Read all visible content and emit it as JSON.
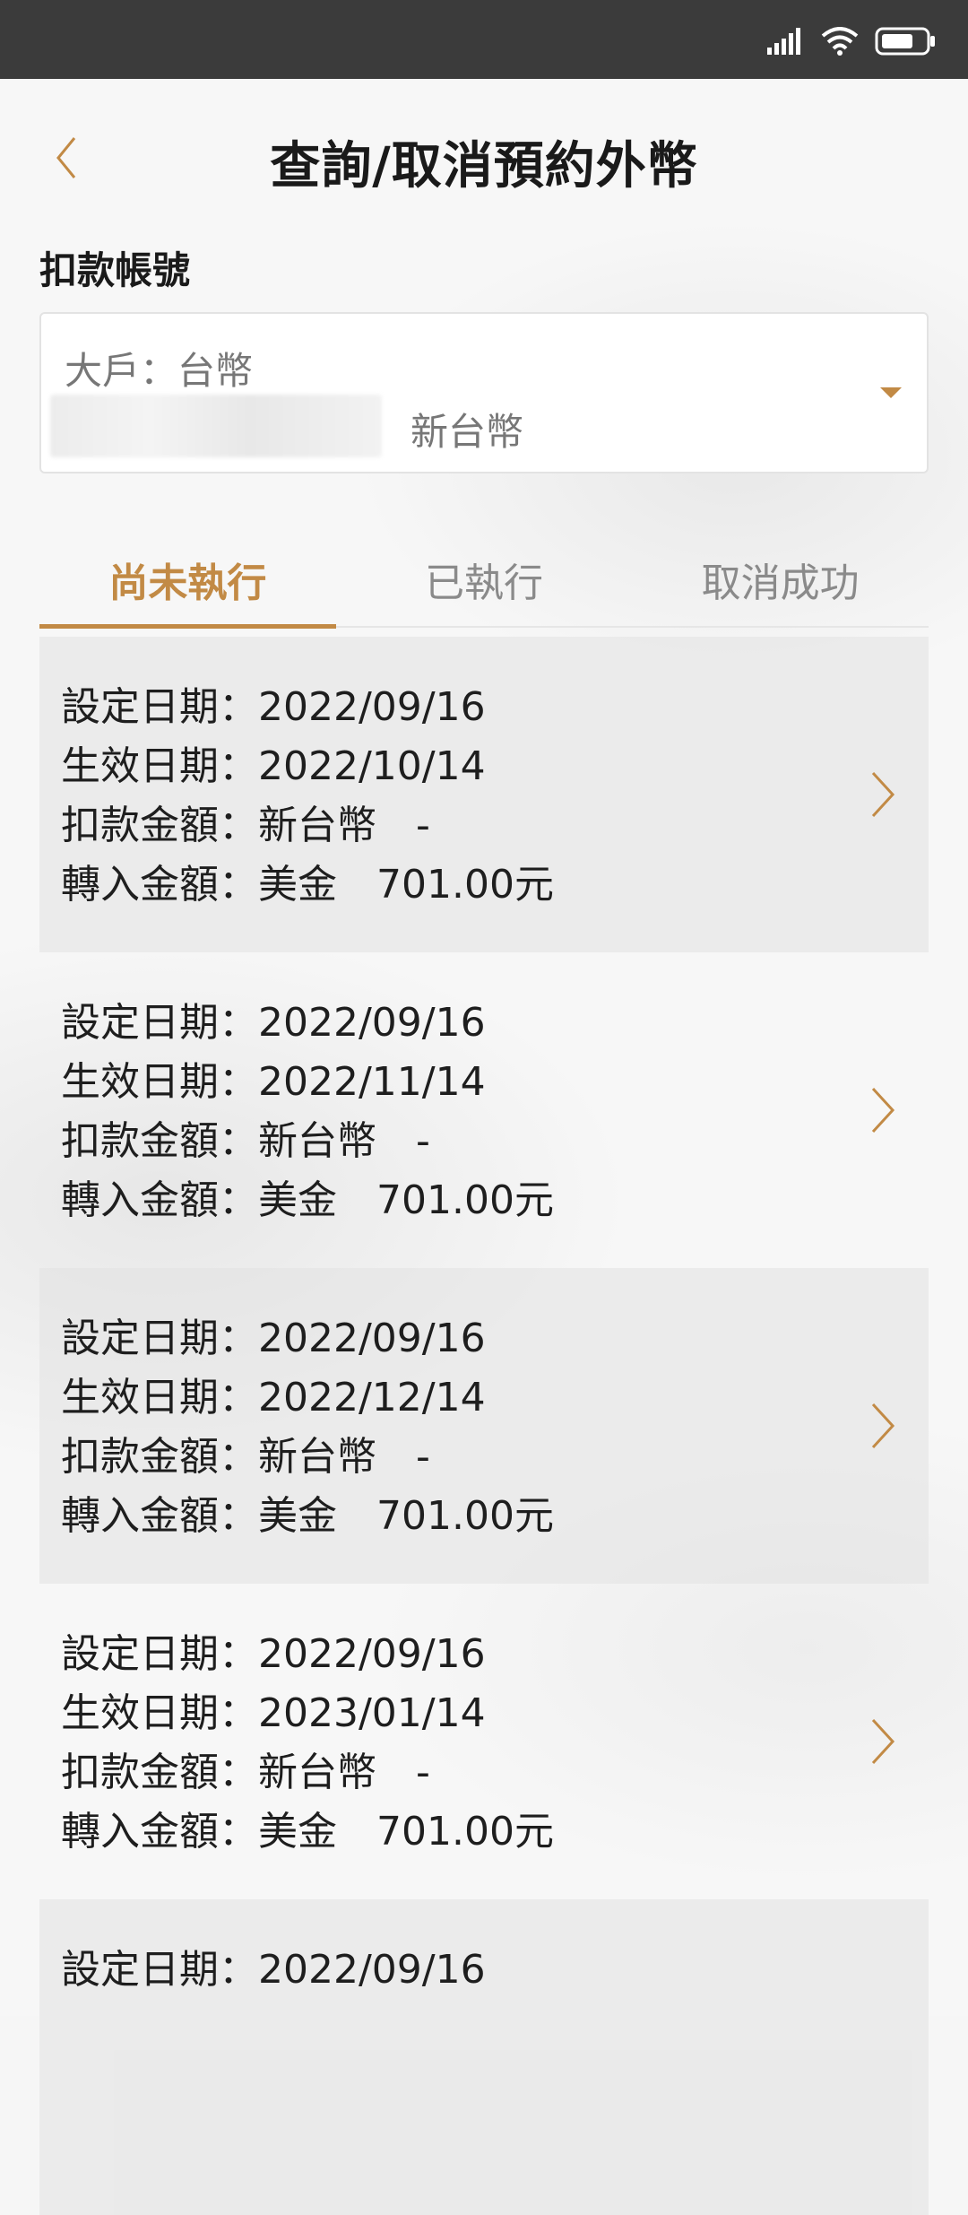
{
  "header": {
    "title": "查詢/取消預約外幣"
  },
  "account": {
    "section_label": "扣款帳號",
    "account_type": "大戶：台幣",
    "currency": "新台幣"
  },
  "tabs": [
    {
      "label": "尚未執行",
      "active": true
    },
    {
      "label": "已執行",
      "active": false
    },
    {
      "label": "取消成功",
      "active": false
    }
  ],
  "items": [
    {
      "set_date": "設定日期：2022/09/16",
      "effective_date": "生效日期：2022/10/14",
      "debit_amount": "扣款金額：新台幣　-",
      "credit_amount": "轉入金額：美金　701.00元"
    },
    {
      "set_date": "設定日期：2022/09/16",
      "effective_date": "生效日期：2022/11/14",
      "debit_amount": "扣款金額：新台幣　-",
      "credit_amount": "轉入金額：美金　701.00元"
    },
    {
      "set_date": "設定日期：2022/09/16",
      "effective_date": "生效日期：2022/12/14",
      "debit_amount": "扣款金額：新台幣　-",
      "credit_amount": "轉入金額：美金　701.00元"
    },
    {
      "set_date": "設定日期：2022/09/16",
      "effective_date": "生效日期：2023/01/14",
      "debit_amount": "扣款金額：新台幣　-",
      "credit_amount": "轉入金額：美金　701.00元"
    },
    {
      "set_date": "設定日期：2022/09/16",
      "effective_date": "",
      "debit_amount": "",
      "credit_amount": ""
    }
  ],
  "colors": {
    "accent": "#c28a45",
    "status_bar": "#3b3b3b"
  },
  "icons": {
    "back": "chevron-left-icon",
    "dropdown": "caret-down-icon",
    "item_arrow": "chevron-right-icon",
    "signal": "signal-icon",
    "wifi": "wifi-icon",
    "battery": "battery-icon"
  }
}
